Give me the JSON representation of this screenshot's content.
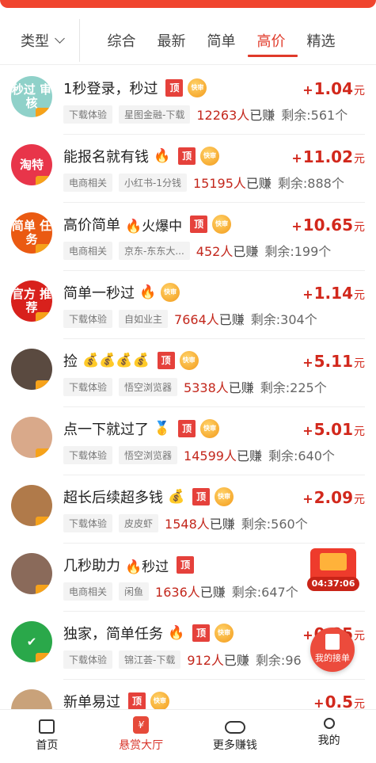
{
  "filter": {
    "type_label": "类型",
    "sort_tabs": [
      "综合",
      "最新",
      "简单",
      "高价",
      "精选"
    ],
    "active_tab": "高价"
  },
  "badges": {
    "top": "顶",
    "fast": "快审"
  },
  "items": [
    {
      "title": "1秒登录，秒过",
      "emoji": "",
      "category": "下载体验",
      "platform": "星图金融-下载",
      "earned": "12263人",
      "earned_suffix": "已赚",
      "remain": "剩余:561个",
      "reward": "1.04",
      "has_top": true,
      "has_fast": true,
      "avatar_text": "秒过 审核",
      "avatar_color": "#8fd1c9"
    },
    {
      "title": "能报名就有钱",
      "emoji": "🔥",
      "category": "电商相关",
      "platform": "小红书-1分钱",
      "earned": "15195人",
      "earned_suffix": "已赚",
      "remain": "剩余:888个",
      "reward": "11.02",
      "has_top": true,
      "has_fast": true,
      "avatar_text": "淘特",
      "avatar_color": "#e8354a"
    },
    {
      "title": "高价简单",
      "emoji": "🔥火爆中",
      "category": "电商相关",
      "platform": "京东-东东大...",
      "earned": "452人",
      "earned_suffix": "已赚",
      "remain": "剩余:199个",
      "reward": "10.65",
      "has_top": true,
      "has_fast": true,
      "avatar_text": "简单 任务",
      "avatar_color": "#ea5a12"
    },
    {
      "title": "简单一秒过",
      "emoji": "🔥",
      "category": "下载体验",
      "platform": "自如业主",
      "earned": "7664人",
      "earned_suffix": "已赚",
      "remain": "剩余:304个",
      "reward": "1.14",
      "has_top": false,
      "has_fast": true,
      "avatar_text": "官方 推荐",
      "avatar_color": "#d8211c"
    },
    {
      "title": "捡",
      "emoji": "💰💰💰💰",
      "category": "下载体验",
      "platform": "悟空浏览器",
      "earned": "5338人",
      "earned_suffix": "已赚",
      "remain": "剩余:225个",
      "reward": "5.11",
      "has_top": true,
      "has_fast": true,
      "avatar_text": "",
      "avatar_color": "#5a4a40"
    },
    {
      "title": "点一下就过了",
      "emoji": "🥇",
      "category": "下载体验",
      "platform": "悟空浏览器",
      "earned": "14599人",
      "earned_suffix": "已赚",
      "remain": "剩余:640个",
      "reward": "5.01",
      "has_top": true,
      "has_fast": true,
      "avatar_text": "",
      "avatar_color": "#d9a98a"
    },
    {
      "title": "超长后续超多钱",
      "emoji": "💰",
      "category": "下载体验",
      "platform": "皮皮虾",
      "earned": "1548人",
      "earned_suffix": "已赚",
      "remain": "剩余:560个",
      "reward": "2.09",
      "has_top": true,
      "has_fast": true,
      "avatar_text": "",
      "avatar_color": "#b07a4a"
    },
    {
      "title": "几秒助力",
      "emoji": "🔥秒过",
      "category": "电商相关",
      "platform": "闲鱼",
      "earned": "1636人",
      "earned_suffix": "已赚",
      "remain": "剩余:647个",
      "reward": "",
      "has_top": true,
      "has_fast": false,
      "avatar_text": "",
      "avatar_color": "#8a6a5a"
    },
    {
      "title": "独家，简单任务",
      "emoji": "🔥",
      "category": "下载体验",
      "platform": "锦江荟-下载",
      "earned": "912人",
      "earned_suffix": "已赚",
      "remain": "剩余:96",
      "reward": "0.85",
      "has_top": true,
      "has_fast": true,
      "avatar_text": "✔",
      "avatar_color": "#2aa84a"
    },
    {
      "title": "新单易过",
      "emoji": "",
      "category": "",
      "platform": "",
      "earned": "",
      "earned_suffix": "",
      "remain": "",
      "reward": "0.5",
      "has_top": true,
      "has_fast": true,
      "avatar_text": "",
      "avatar_color": "#c9a27a"
    }
  ],
  "reward_prefix": "+",
  "reward_unit": "元",
  "floating": {
    "timer": "04:37:06",
    "my_orders": "我的接单"
  },
  "tabbar": [
    "首页",
    "悬赏大厅",
    "更多赚钱",
    "我的"
  ],
  "colors": {
    "accent": "#e03a2a",
    "reward": "#d2281c"
  }
}
